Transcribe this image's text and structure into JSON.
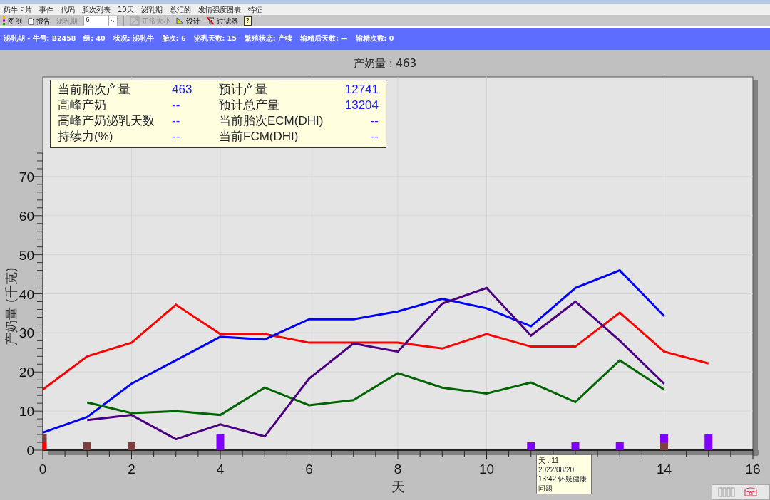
{
  "menu": [
    "奶牛卡片",
    "事件",
    "代码",
    "胎次列表",
    "10天",
    "泌乳期",
    "总汇的",
    "发情强度图表",
    "特征"
  ],
  "toolbar": [
    {
      "kind": "button",
      "label": "图例",
      "disabled": false
    },
    {
      "kind": "button",
      "label": "报告",
      "disabled": false
    },
    {
      "kind": "label",
      "label": "泌乳期",
      "disabled": true
    },
    {
      "kind": "combo",
      "value": "6",
      "disabled": false
    },
    {
      "kind": "separator"
    },
    {
      "kind": "button",
      "label": "正常大小",
      "disabled": true
    },
    {
      "kind": "button",
      "label": "设计",
      "disabled": false
    },
    {
      "kind": "button",
      "label": "过滤器",
      "disabled": false
    },
    {
      "kind": "help",
      "label": "?",
      "disabled": false
    }
  ],
  "header": [
    "泌乳期 - 牛号: B2458",
    "组: 40",
    "状况: 泌乳牛",
    "胎次: 6",
    "泌乳天数: 15",
    "繁殖状态: 产犊",
    "输精后天数: —",
    "输精次数: 0"
  ],
  "chart_title": "产奶量 : 463",
  "info_box": [
    {
      "label": "当前胎次产量",
      "value": "463",
      "label_2": "预计产量",
      "value_2": "12741"
    },
    {
      "label": "高峰产奶",
      "value": "--",
      "label_2": "预计总产量",
      "value_2": "13204"
    },
    {
      "label": "高峰产奶泌乳天数",
      "value": "--",
      "label_2": "当前胎次ECM(DHI)",
      "value_2": "--"
    },
    {
      "label": "持续力(%)",
      "value": "--",
      "label_2": "当前FCM(DHI)",
      "value_2": "--"
    }
  ],
  "chart_data": {
    "type": "line",
    "xlabel": "天",
    "ylabel": "产奶量 (千克)",
    "x": [
      0,
      1,
      2,
      3,
      4,
      5,
      6,
      7,
      8,
      9,
      10,
      11,
      12,
      13,
      14,
      15
    ],
    "grid": true,
    "xlim": [
      0,
      16
    ],
    "ylim": [
      0,
      95.5
    ],
    "xticks": [
      0,
      2,
      4,
      6,
      8,
      10,
      14,
      16
    ],
    "yticks": [
      0,
      10,
      20,
      30,
      40,
      50,
      60,
      70
    ],
    "series": [
      {
        "type": "line",
        "color": "#ff0000",
        "values": [
          15.5,
          24,
          27.5,
          37.2,
          29.7,
          29.7,
          27.5,
          27.5,
          27.5,
          26,
          29.7,
          26.5,
          26.5,
          35.2,
          25.2,
          22.2
        ]
      },
      {
        "type": "line",
        "color": "#0000ff",
        "values": [
          4.5,
          8.5,
          17,
          23,
          29,
          28.3,
          33.5,
          33.5,
          35.5,
          38.7,
          36.3,
          31.7,
          41.5,
          46,
          34.3,
          null
        ]
      },
      {
        "type": "line",
        "color": "#006400",
        "values": [
          null,
          12.2,
          9.5,
          10,
          9,
          16,
          11.5,
          12.8,
          19.7,
          16,
          14.5,
          17.3,
          12.3,
          23,
          15.5,
          null
        ]
      },
      {
        "type": "line",
        "color": "#4b0082",
        "values": [
          null,
          7.7,
          9,
          2.8,
          6.6,
          3.5,
          18.3,
          27.3,
          25.2,
          37.5,
          41.5,
          29.3,
          38,
          28,
          17,
          null
        ]
      },
      {
        "type": "scatter",
        "color": "#ff0000",
        "values": [
          1,
          null,
          null,
          null,
          null,
          null,
          null,
          null,
          null,
          null,
          null,
          null,
          null,
          null,
          null,
          null
        ]
      },
      {
        "type": "scatter",
        "color": "#7f3f3f",
        "values": [
          3,
          1,
          1,
          null,
          null,
          null,
          null,
          null,
          null,
          null,
          null,
          null,
          null,
          null,
          1,
          null
        ]
      },
      {
        "type": "scatter",
        "color": "#8000ff",
        "values": [
          null,
          null,
          null,
          null,
          1,
          null,
          null,
          null,
          null,
          null,
          null,
          1,
          1,
          1,
          null,
          1
        ]
      },
      {
        "type": "scatter",
        "color": "#8000ff",
        "values": [
          null,
          null,
          null,
          null,
          3,
          null,
          null,
          null,
          null,
          null,
          null,
          null,
          null,
          null,
          3,
          3
        ]
      }
    ]
  },
  "tooltip": [
    "天 : 11",
    "2022/08/20",
    "13:42 怀疑健康",
    "问题"
  ]
}
